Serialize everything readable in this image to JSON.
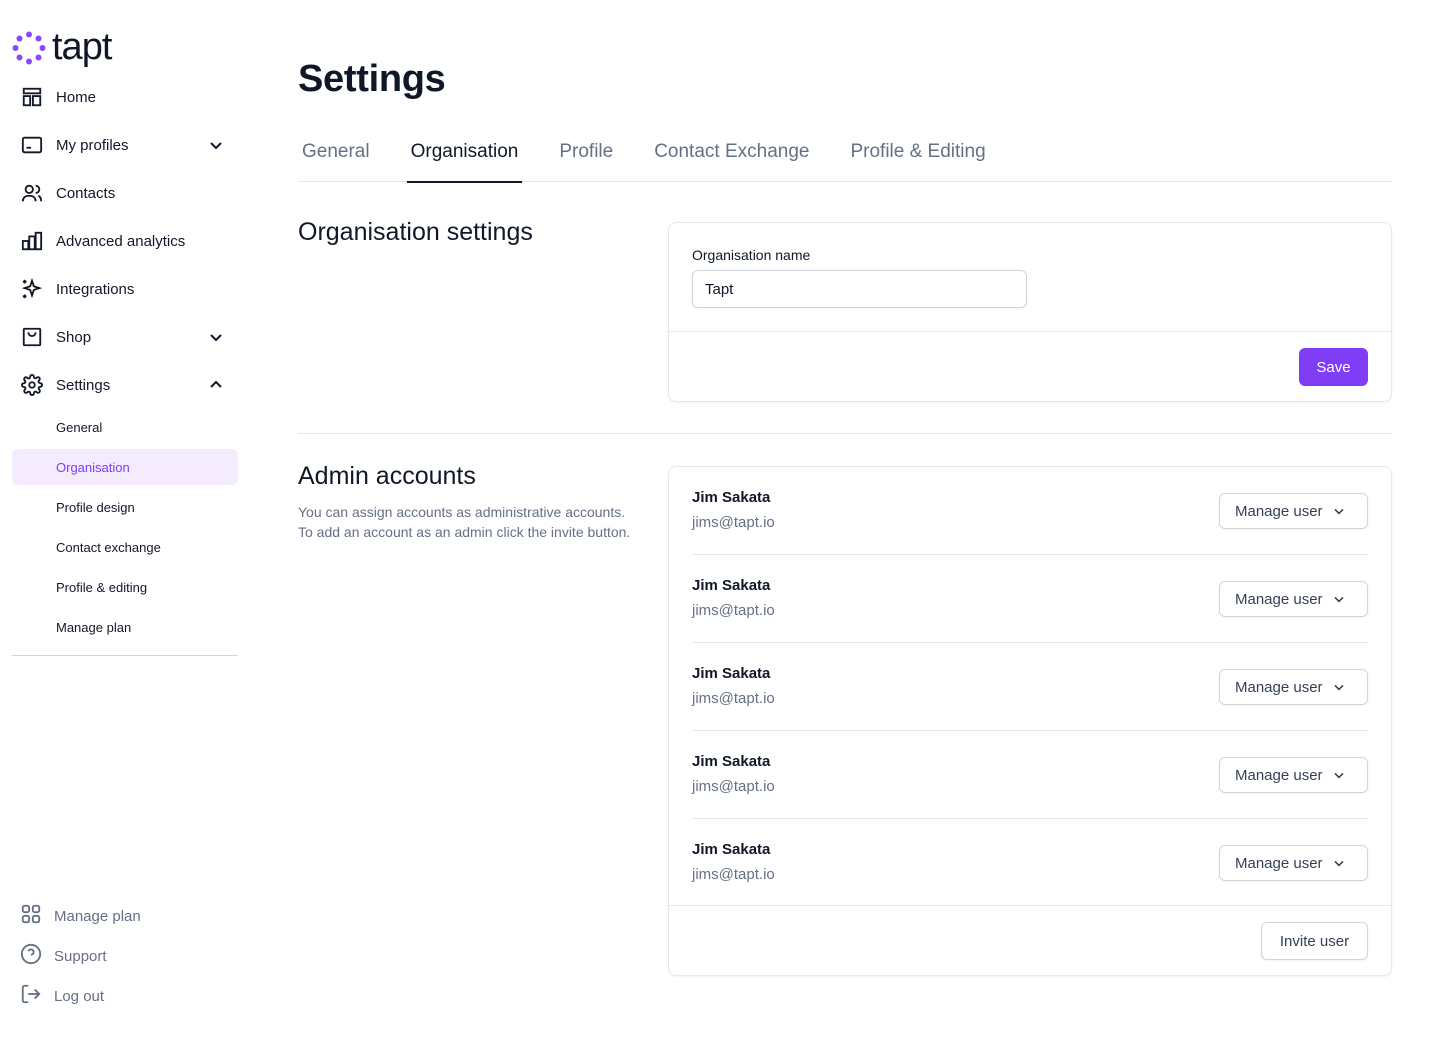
{
  "app": {
    "logo_text": "tapt"
  },
  "sidebar": {
    "items": [
      {
        "label": "Home",
        "icon": "home-icon"
      },
      {
        "label": "My profiles",
        "icon": "profile-card-icon",
        "chevron": "down"
      },
      {
        "label": "Contacts",
        "icon": "users-icon"
      },
      {
        "label": "Advanced analytics",
        "icon": "bar-chart-icon"
      },
      {
        "label": "Integrations",
        "icon": "sparkle-icon"
      },
      {
        "label": "Shop",
        "icon": "shopping-bag-icon",
        "chevron": "down"
      },
      {
        "label": "Settings",
        "icon": "gear-icon",
        "chevron": "up"
      }
    ],
    "settings_sub": [
      {
        "label": "General"
      },
      {
        "label": "Organisation",
        "active": true
      },
      {
        "label": "Profile design"
      },
      {
        "label": "Contact exchange"
      },
      {
        "label": "Profile & editing"
      },
      {
        "label": "Manage plan"
      }
    ],
    "bottom": [
      {
        "label": "Manage plan",
        "icon": "grid-icon"
      },
      {
        "label": "Support",
        "icon": "help-circle-icon"
      },
      {
        "label": "Log out",
        "icon": "logout-icon"
      }
    ]
  },
  "page": {
    "title": "Settings",
    "tabs": [
      {
        "label": "General"
      },
      {
        "label": "Organisation",
        "active": true
      },
      {
        "label": "Profile"
      },
      {
        "label": "Contact Exchange"
      },
      {
        "label": "Profile & Editing"
      }
    ]
  },
  "org_settings": {
    "title": "Organisation settings",
    "field_label": "Organisation name",
    "field_value": "Tapt",
    "save_label": "Save"
  },
  "admin_accounts": {
    "title": "Admin accounts",
    "description": "You can assign accounts as administrative accounts. To add an account as an admin click the invite button.",
    "users": [
      {
        "name": "Jim Sakata",
        "email": "jims@tapt.io",
        "action": "Manage user"
      },
      {
        "name": "Jim Sakata",
        "email": "jims@tapt.io",
        "action": "Manage user"
      },
      {
        "name": "Jim Sakata",
        "email": "jims@tapt.io",
        "action": "Manage user"
      },
      {
        "name": "Jim Sakata",
        "email": "jims@tapt.io",
        "action": "Manage user"
      },
      {
        "name": "Jim Sakata",
        "email": "jims@tapt.io",
        "action": "Manage user"
      }
    ],
    "invite_label": "Invite user"
  },
  "colors": {
    "accent": "#7f3df5",
    "accent_light": "#f4ebff",
    "text_primary": "#101828",
    "text_secondary": "#667085",
    "border": "#e4e7ec"
  }
}
